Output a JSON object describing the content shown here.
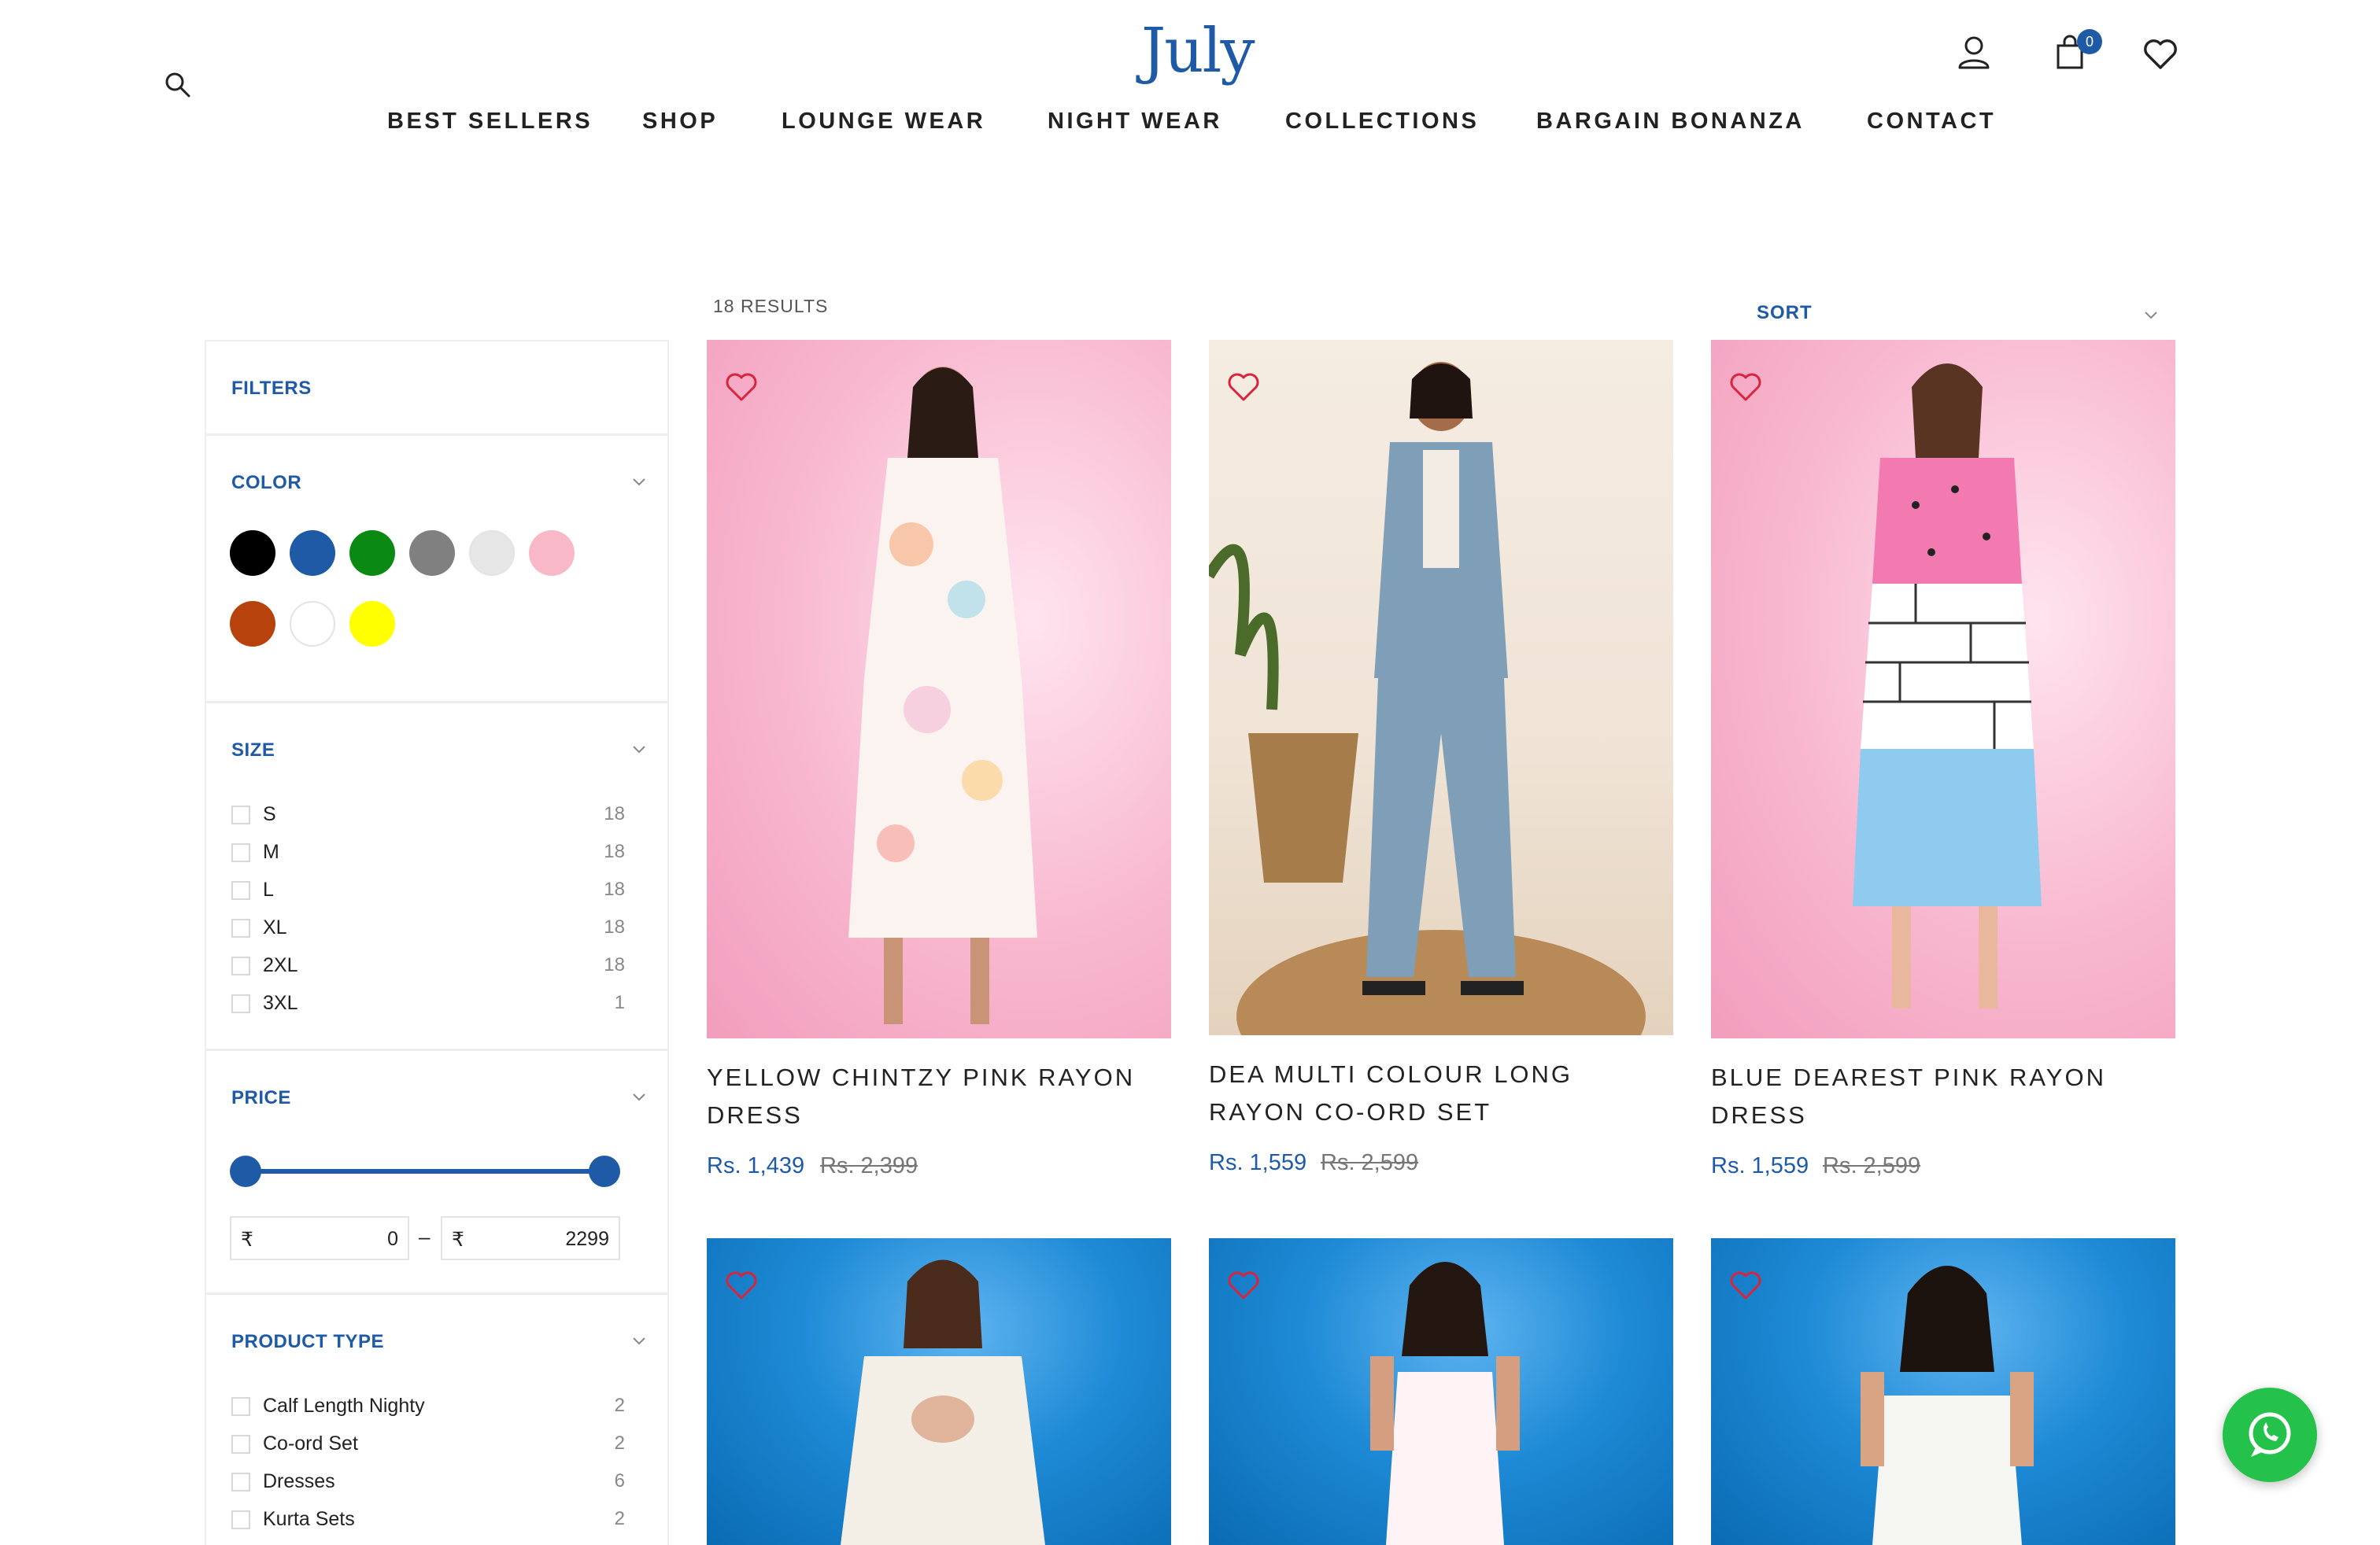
{
  "brand": {
    "logo_text": "July",
    "accent": "#1e5aa6"
  },
  "header": {
    "search_icon": "search-icon",
    "account_icon": "user-icon",
    "cart_icon": "shopping-bag-icon",
    "cart_count": "0",
    "wishlist_icon": "heart-icon"
  },
  "nav": {
    "items": [
      {
        "label": "BEST SELLERS"
      },
      {
        "label": "SHOP"
      },
      {
        "label": "LOUNGE WEAR"
      },
      {
        "label": "NIGHT WEAR"
      },
      {
        "label": "COLLECTIONS"
      },
      {
        "label": "BARGAIN BONANZA"
      },
      {
        "label": "CONTACT"
      }
    ]
  },
  "results": {
    "count_label": "18 RESULTS",
    "sort_label": "SORT"
  },
  "filters": {
    "title": "FILTERS",
    "color": {
      "title": "COLOR",
      "swatches": [
        "#000000",
        "#1e5aa6",
        "#0a8a12",
        "#808080",
        "#e6e6e6",
        "#f8b8c8",
        "#b8420c",
        "#ffffff",
        "#ffff00"
      ]
    },
    "size": {
      "title": "SIZE",
      "options": [
        {
          "label": "S",
          "count": "18"
        },
        {
          "label": "M",
          "count": "18"
        },
        {
          "label": "L",
          "count": "18"
        },
        {
          "label": "XL",
          "count": "18"
        },
        {
          "label": "2XL",
          "count": "18"
        },
        {
          "label": "3XL",
          "count": "1"
        }
      ]
    },
    "price": {
      "title": "PRICE",
      "currency": "₹",
      "min": "0",
      "max": "2299",
      "separator": "–"
    },
    "product_type": {
      "title": "PRODUCT TYPE",
      "options": [
        {
          "label": "Calf Length Nighty",
          "count": "2"
        },
        {
          "label": "Co-ord Set",
          "count": "2"
        },
        {
          "label": "Dresses",
          "count": "6"
        },
        {
          "label": "Kurta Sets",
          "count": "2"
        }
      ]
    }
  },
  "products": [
    {
      "title": "YELLOW CHINTZY PINK RAYON DRESS",
      "sale_price": "Rs. 1,439",
      "original_price": "Rs. 2,399"
    },
    {
      "title": "DEA MULTI COLOUR LONG RAYON CO-ORD SET",
      "sale_price": "Rs. 1,559",
      "original_price": "Rs. 2,599"
    },
    {
      "title": "BLUE DEAREST PINK RAYON DRESS",
      "sale_price": "Rs. 1,559",
      "original_price": "Rs. 2,599"
    },
    {
      "title": "",
      "sale_price": "",
      "original_price": ""
    },
    {
      "title": "",
      "sale_price": "",
      "original_price": ""
    },
    {
      "title": "",
      "sale_price": "",
      "original_price": ""
    }
  ],
  "floating": {
    "whatsapp_icon": "whatsapp-icon"
  }
}
